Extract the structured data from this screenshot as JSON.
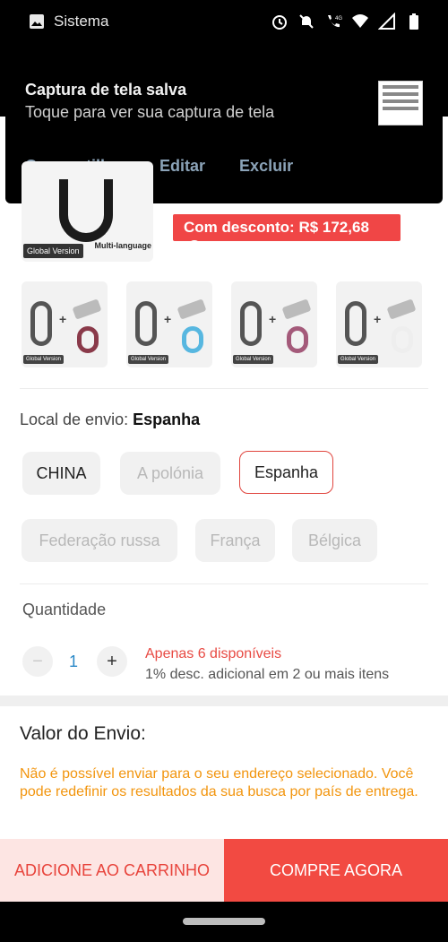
{
  "status_bar": {
    "app_label": "Sistema",
    "icons": [
      "image-icon",
      "alarm-icon",
      "notifications-off-icon",
      "wifi-call-icon",
      "wifi-icon",
      "signal-icon",
      "battery-icon"
    ],
    "network_label": "4G"
  },
  "notification": {
    "title": "Captura de tela salva",
    "subtitle": "Toque para ver sua captura de tela",
    "actions": [
      "Compartilhar",
      "Editar",
      "Excluir"
    ]
  },
  "product": {
    "main_image_badge": "Global Version",
    "main_image_caption": "Multi-language",
    "discount_label": "Com desconto: R$ 172,68",
    "discount_help": "?",
    "thumbnails": [
      {
        "strap_color": "#8a3a4a",
        "badge": "Global Version"
      },
      {
        "strap_color": "#57b7e0",
        "badge": "Global Version"
      },
      {
        "strap_color": "#a45a7a",
        "badge": "Global Version"
      },
      {
        "strap_color": "#eeeeee",
        "badge": "Global Version"
      }
    ]
  },
  "shipping_from": {
    "label": "Local de envio:",
    "selected": "Espanha",
    "options": [
      {
        "label": "CHINA",
        "state": "available"
      },
      {
        "label": "A polónia",
        "state": "disabled"
      },
      {
        "label": "Espanha",
        "state": "selected"
      },
      {
        "label": "Federação russa",
        "state": "disabled"
      },
      {
        "label": "França",
        "state": "disabled"
      },
      {
        "label": "Bélgica",
        "state": "disabled"
      }
    ]
  },
  "quantity": {
    "label": "Quantidade",
    "minus": "−",
    "value": "1",
    "plus": "+",
    "stock_text": "Apenas 6 disponíveis",
    "bulk_text": "1% desc. adicional em 2 ou mais itens"
  },
  "shipping_value": {
    "title": "Valor do Envio:",
    "warning": "Não é possível enviar para o seu endereço selecionado. Você pode redefinir os resultados da sua busca por país de entrega."
  },
  "actions": {
    "add_to_cart": "ADICIONE AO CARRINHO",
    "buy_now": "COMPRE AGORA"
  },
  "colors": {
    "accent": "#f24a42",
    "warning": "#f2950e",
    "link": "#2b89c8"
  }
}
